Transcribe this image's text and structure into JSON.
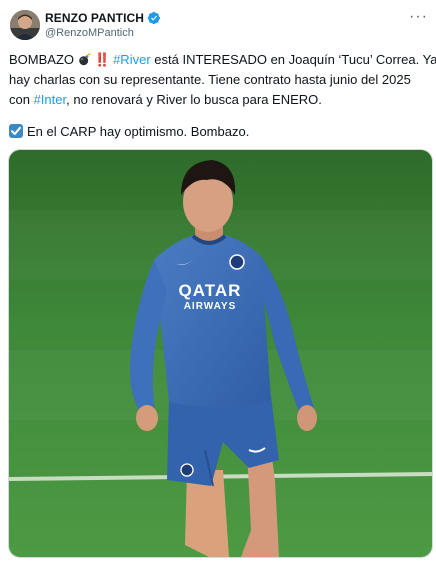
{
  "author": {
    "display_name": "RENZO PANTICH",
    "handle": "@RenzoMPantich",
    "verified": true
  },
  "tweet": {
    "line1_pre": "BOMBAZO",
    "line1_bang": "‼️",
    "line1_tag": "#River",
    "line1_post": " está INTERESADO en Joaquín ‘Tucu’ Correa. Ya",
    "line2": "hay charlas con su representante. Tiene contrato hasta junio del 2025",
    "line3_pre": "con ",
    "line3_tag": "#Inter",
    "line3_post": ", no renovará y River lo busca para ENERO.",
    "second_paragraph": "En el CARP hay optimismo. Bombazo."
  },
  "media": {
    "shirt_sponsor_line1": "QATAR",
    "shirt_sponsor_line2": "AIRWAYS"
  },
  "icons": {
    "verified": "verified-badge-icon",
    "more": "more-options-icon",
    "bomb": "bomb-emoji-icon",
    "check": "check-mark-button-emoji-icon"
  },
  "colors": {
    "accent": "#1d9bf0",
    "text": "#0f1419",
    "secondary": "#536471",
    "pitch": "#3f8a3a",
    "kit": "#3d6fb8"
  }
}
